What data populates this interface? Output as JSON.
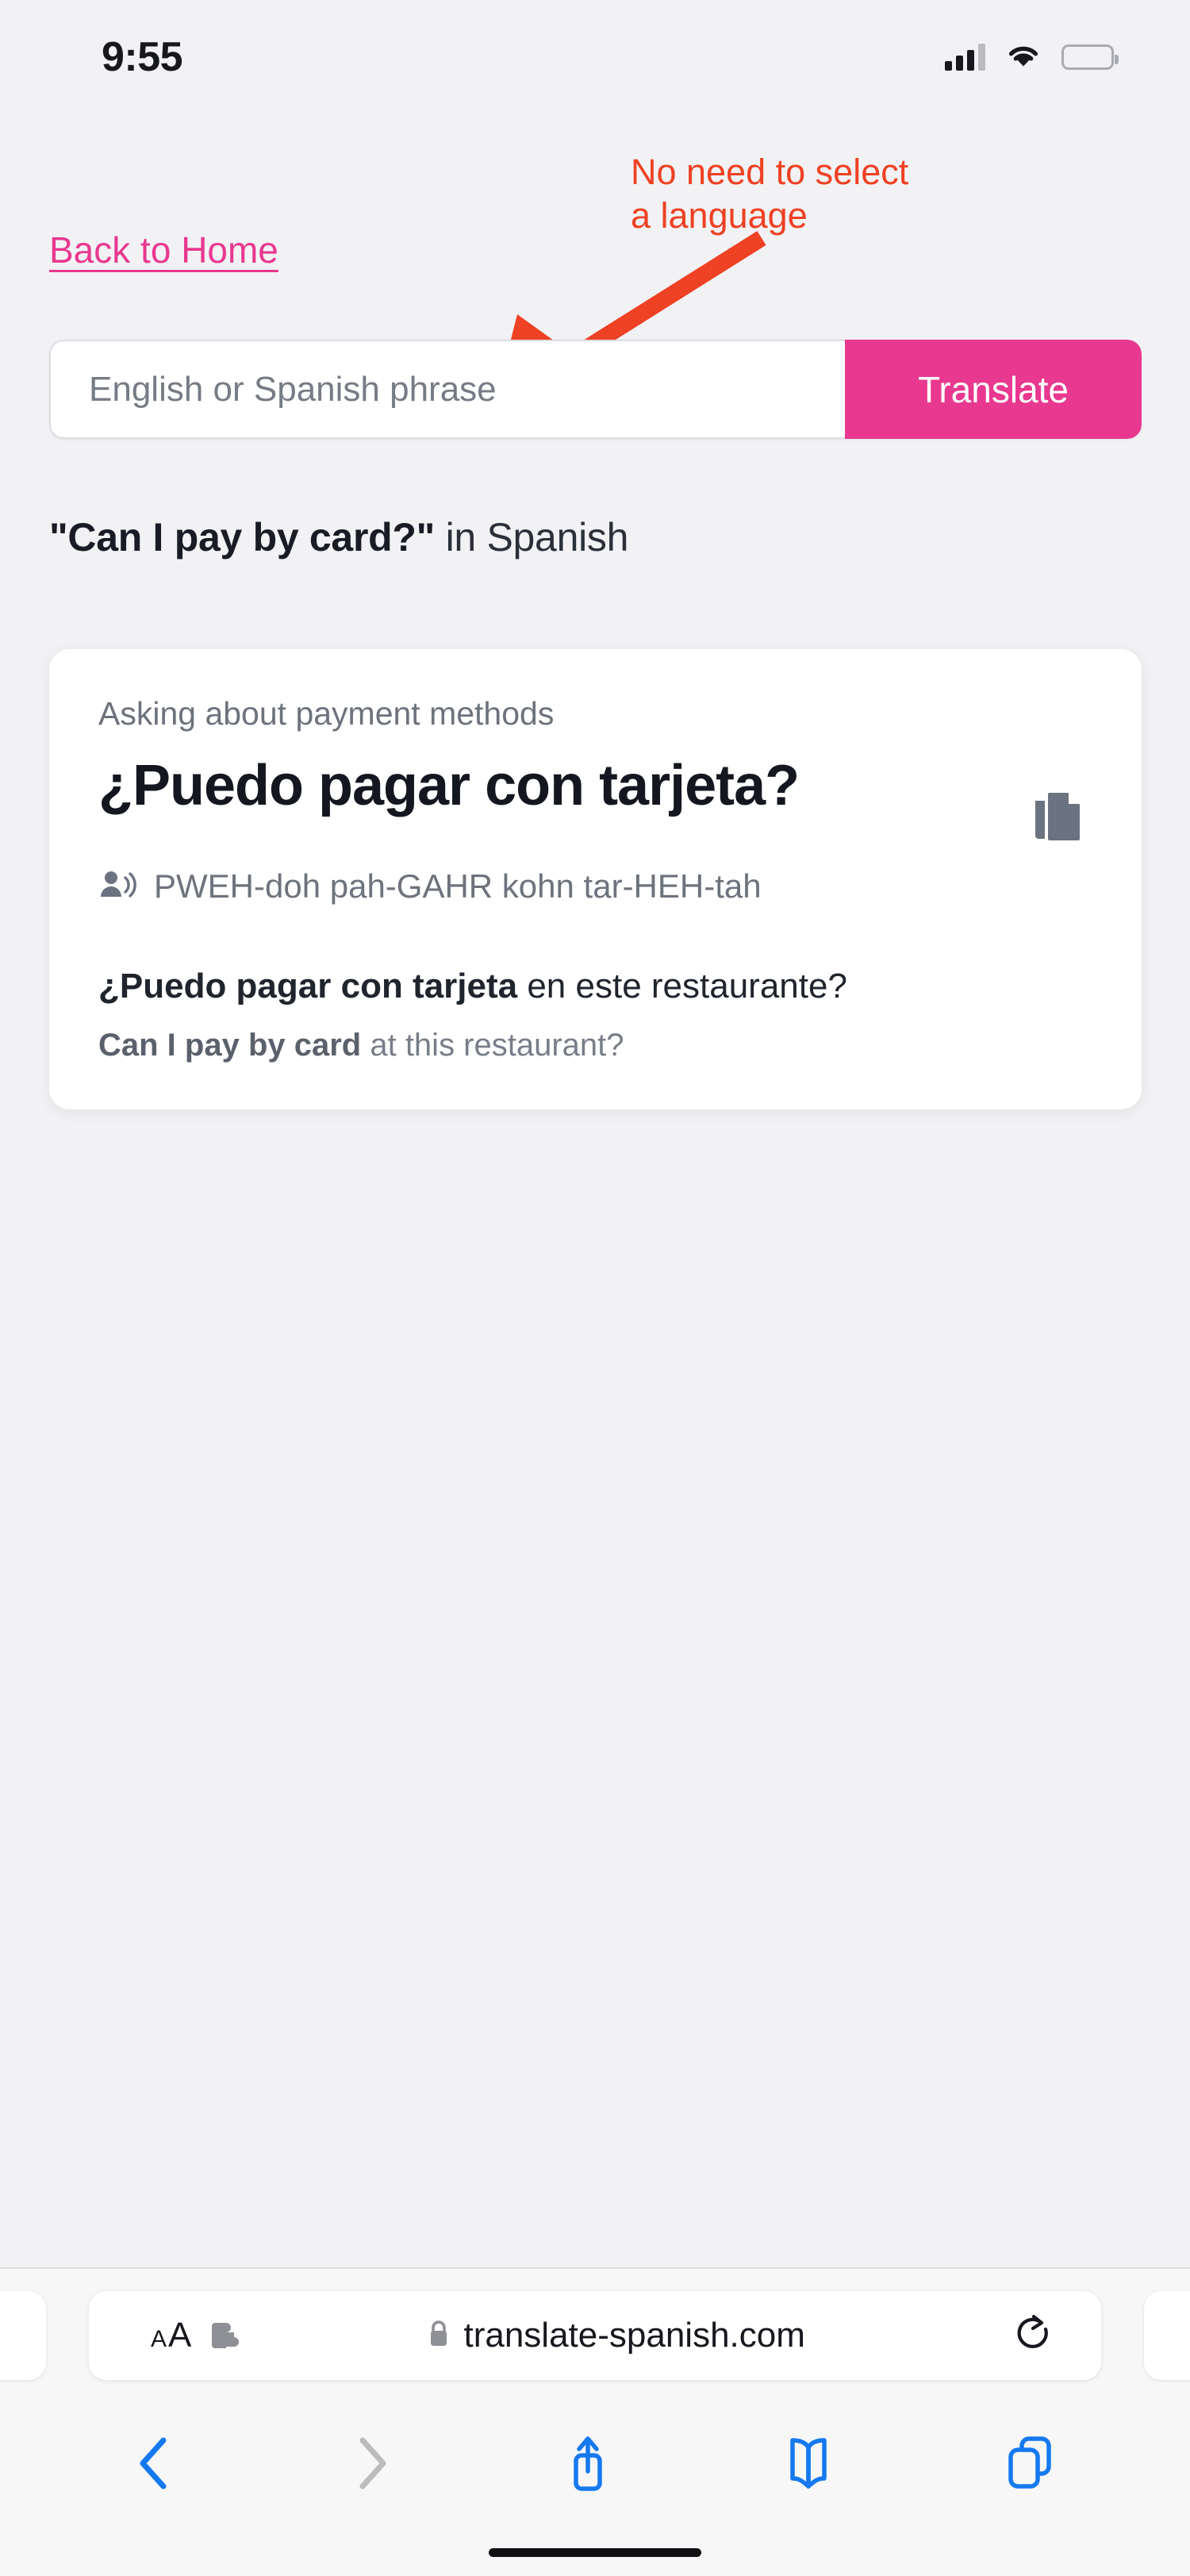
{
  "status_bar": {
    "time": "9:55",
    "signal_icon": "cellular-signal-icon",
    "wifi_icon": "wifi-icon",
    "battery_icon": "battery-icon",
    "battery_color": "#fdc300"
  },
  "annotation": {
    "text": "No need to select\na language",
    "color": "#ef4123",
    "arrow_icon": "red-arrow-icon"
  },
  "page": {
    "back_link": "Back to Home",
    "search": {
      "placeholder": "English or Spanish phrase",
      "value": "",
      "button_label": "Translate",
      "button_color": "#e8388f"
    },
    "result_heading": {
      "quoted": "\"Can I pay by card?\"",
      "suffix": " in Spanish"
    },
    "card": {
      "context": "Asking about payment methods",
      "translation": "¿Puedo pagar con tarjeta?",
      "pronunciation": "PWEH-doh pah-GAHR kohn tar-HEH-tah",
      "pronunciation_icon": "speaker-person-icon",
      "copy_icon": "copy-icon",
      "example_es_bold": "¿Puedo pagar con tarjeta",
      "example_es_rest": " en este restaurante?",
      "example_en_bold": "Can I pay by card",
      "example_en_rest": " at this restaurant?"
    }
  },
  "browser": {
    "text_size_small": "A",
    "text_size_big": "A",
    "extensions_icon": "puzzle-piece-icon",
    "lock_icon": "lock-icon",
    "url": "translate-spanish.com",
    "reload_icon": "reload-icon",
    "toolbar": {
      "back_icon": "chevron-left-icon",
      "forward_icon": "chevron-right-icon",
      "share_icon": "share-icon",
      "bookmarks_icon": "book-icon",
      "tabs_icon": "tabs-icon",
      "accent_color": "#1579ef",
      "disabled_color": "#bcbcbf"
    }
  }
}
